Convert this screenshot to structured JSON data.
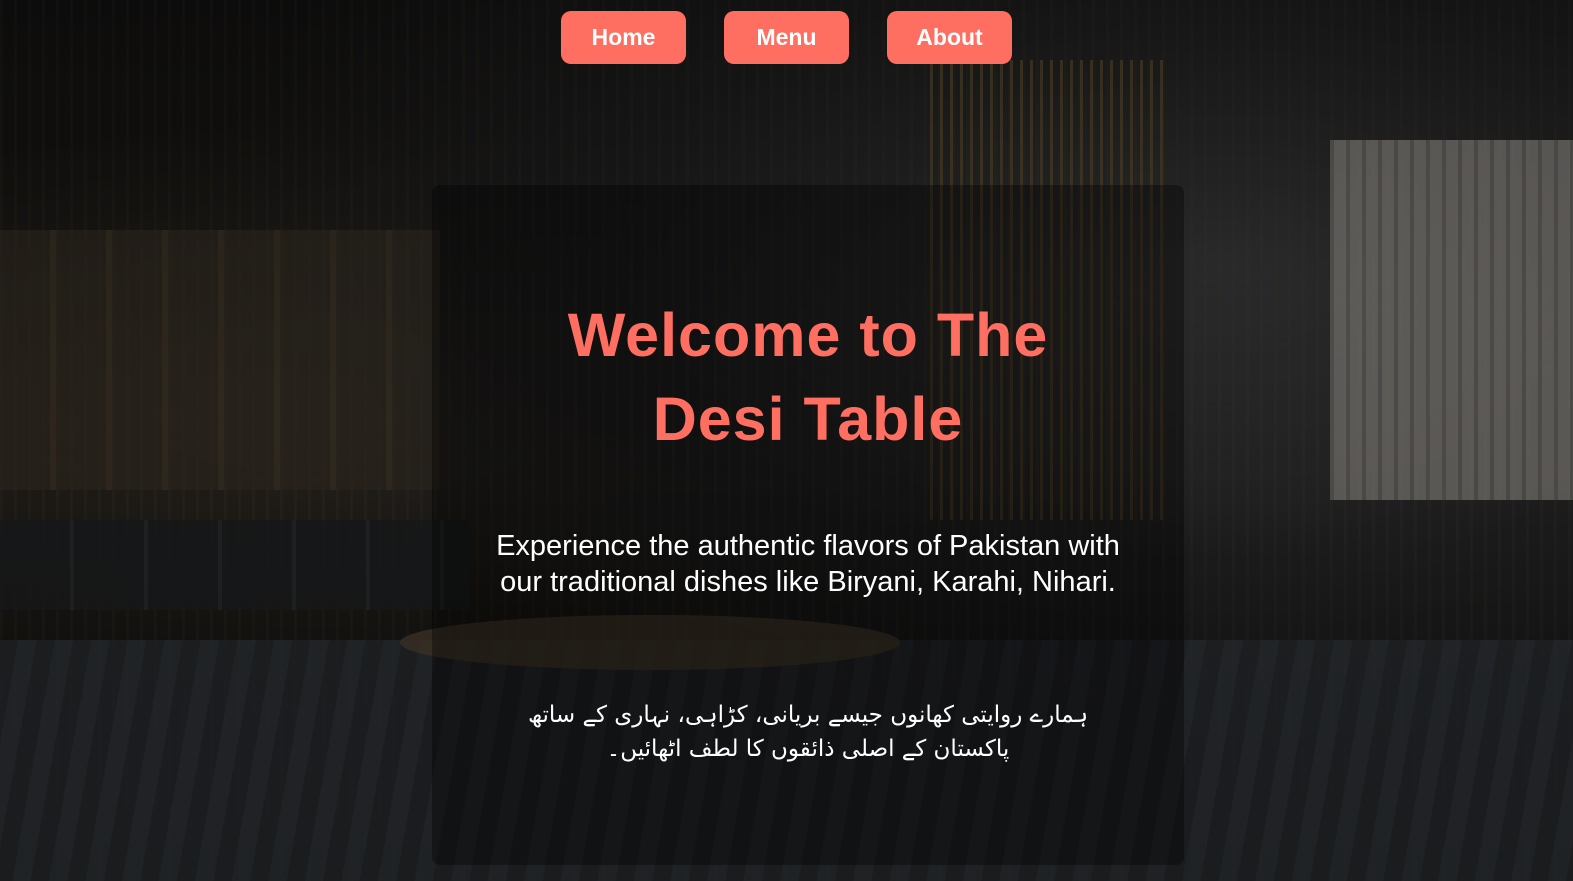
{
  "nav": {
    "items": [
      {
        "label": "Home"
      },
      {
        "label": "Menu"
      },
      {
        "label": "About"
      }
    ]
  },
  "hero": {
    "title": "Welcome to The Desi Table",
    "description": "Experience the authentic flavors of Pakistan with our traditional dishes like Biryani, Karahi, Nihari.",
    "description_urdu": "ہمارے روایتی کھانوں جیسے بریانی، کڑاہی، نہاری کے ساتھ پاکستان کے اصلی ذائقوں کا لطف اٹھائیں۔"
  },
  "colors": {
    "accent": "#ff6f61",
    "text": "#ffffff"
  }
}
